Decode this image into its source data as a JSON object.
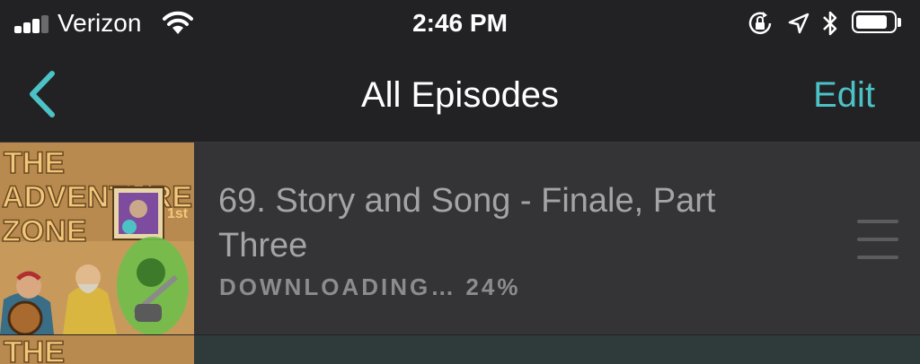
{
  "status_bar": {
    "carrier": "Verizon",
    "time": "2:46 PM",
    "signal_bars_filled": 3,
    "signal_bars_total": 5,
    "battery_level": 0.85,
    "icons": [
      "signal-icon",
      "wifi-icon",
      "orientation-lock-icon",
      "location-icon",
      "bluetooth-icon",
      "battery-icon"
    ]
  },
  "nav": {
    "title": "All Episodes",
    "edit_label": "Edit",
    "back_icon": "chevron-left-icon"
  },
  "colors": {
    "accent": "#4cc2c7",
    "background": "#222224",
    "row_background": "#343436",
    "title_text": "#a4a4a6",
    "status_text": "#8c8c8e"
  },
  "episodes": [
    {
      "artwork_text": [
        "THE",
        "ADVENTURE",
        "ZONE"
      ],
      "artwork_badge": "1st",
      "title": "69. Story and Song - Finale, Part Three",
      "status": "DOWNLOADING… 24%",
      "download_progress": 0.24
    },
    {
      "artwork_text": [
        "THE"
      ]
    }
  ]
}
